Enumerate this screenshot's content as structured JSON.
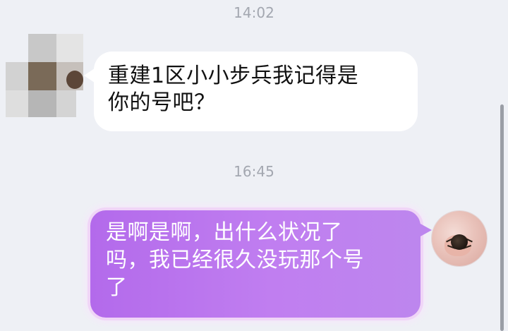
{
  "timestamps": [
    "14:02",
    "16:45"
  ],
  "messages": [
    {
      "direction": "incoming",
      "lines": [
        "重建1区小小步兵我记得是",
        "你的号吧？"
      ],
      "avatar": "blurred-avatar-icon"
    },
    {
      "direction": "outgoing",
      "lines": [
        "是啊是啊，出什么状况了",
        "吗，我已经很久没玩那个号",
        "了"
      ],
      "avatar": "beetle-in-hand-avatar-icon"
    }
  ],
  "colors": {
    "background": "#eef0f5",
    "incoming_bubble": "#ffffff",
    "outgoing_bubble": "#c07ef0",
    "timestamp_text": "#a3a7b0"
  }
}
